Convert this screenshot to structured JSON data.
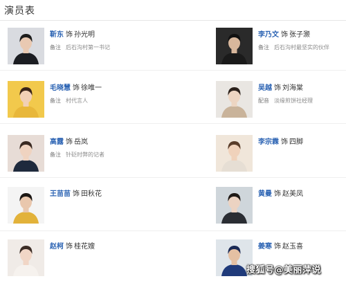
{
  "page": {
    "title": "演员表"
  },
  "shi": "饰",
  "cast": [
    {
      "actor": "靳东",
      "role": "孙光明",
      "note_label": "备注",
      "note": "后石沟村第一书记",
      "colors": {
        "bg": "#d9dbe0",
        "hair": "#1d1d1d",
        "skin": "#e9c9b2",
        "cloth": "#1b1d22"
      }
    },
    {
      "actor": "李乃文",
      "role": "张子灏",
      "note_label": "备注",
      "note": "后石沟村最坚实的伙伴",
      "colors": {
        "bg": "#2a2a2a",
        "hair": "#111111",
        "skin": "#d8b79c",
        "cloth": "#1a1a1a"
      }
    },
    {
      "actor": "毛晓慧",
      "role": "徐唯一",
      "note_label": "备注",
      "note": "村代言人",
      "colors": {
        "bg": "#f2c94c",
        "hair": "#3a2418",
        "skin": "#f1d0b6",
        "cloth": "#e8b73a"
      }
    },
    {
      "actor": "吴越",
      "role": "刘海棠",
      "note_label": "配音",
      "note": "淡缘煎饼社经理",
      "colors": {
        "bg": "#e9e6e2",
        "hair": "#2b211b",
        "skin": "#edd5c2",
        "cloth": "#c9b39a"
      }
    },
    {
      "actor": "高露",
      "role": "岳岚",
      "note_label": "备注",
      "note": "针砭时弊的记者",
      "colors": {
        "bg": "#e7dcd6",
        "hair": "#3a2a22",
        "skin": "#efd3c0",
        "cloth": "#1f2a3d"
      }
    },
    {
      "actor": "李宗霖",
      "role": "四脚",
      "note_label": "",
      "note": "",
      "colors": {
        "bg": "#f0e6da",
        "hair": "#5a3d2a",
        "skin": "#f0d2bb",
        "cloth": "#e6ded4"
      }
    },
    {
      "actor": "王苗苗",
      "role": "田秋花",
      "note_label": "",
      "note": "",
      "colors": {
        "bg": "#f4f4f4",
        "hair": "#1c1714",
        "skin": "#e9c7ad",
        "cloth": "#e2b23a"
      }
    },
    {
      "actor": "黄曼",
      "role": "赵美凤",
      "note_label": "",
      "note": "",
      "colors": {
        "bg": "#cfd6db",
        "hair": "#1f1a17",
        "skin": "#ecd3c2",
        "cloth": "#2a2d33"
      }
    },
    {
      "actor": "赵柯",
      "role": "桂花嫂",
      "note_label": "",
      "note": "",
      "colors": {
        "bg": "#f0ebe7",
        "hair": "#3b2c25",
        "skin": "#f1d6c6",
        "cloth": "#f6f2ee"
      }
    },
    {
      "actor": "姜寒",
      "role": "赵玉喜",
      "note_label": "",
      "note": "",
      "colors": {
        "bg": "#dfe5ea",
        "hair": "#1b2a55",
        "skin": "#e4c0a3",
        "cloth": "#1f3a7a"
      }
    }
  ],
  "watermark": "搜狐号@美丽萍说"
}
